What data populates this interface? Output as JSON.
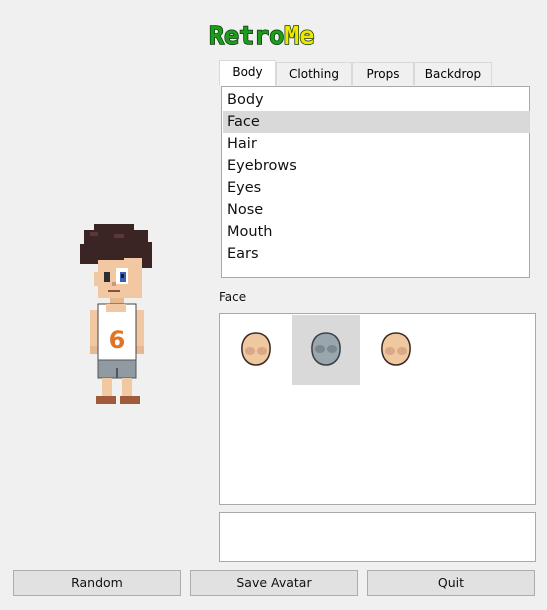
{
  "app": {
    "logo_text": "RetroMe"
  },
  "tabs": [
    {
      "label": "Body",
      "active": true
    },
    {
      "label": "Clothing",
      "active": false
    },
    {
      "label": "Props",
      "active": false
    },
    {
      "label": "Backdrop",
      "active": false
    }
  ],
  "body_parts": {
    "items": [
      "Body",
      "Face",
      "Hair",
      "Eyebrows",
      "Eyes",
      "Nose",
      "Mouth",
      "Ears"
    ],
    "selected": "Face"
  },
  "options": {
    "label": "Face",
    "items": [
      {
        "icon": "face-shape-icon",
        "color": "#f0c8a0",
        "selected": false
      },
      {
        "icon": "face-shape-icon",
        "color": "#9aa6ad",
        "selected": true
      },
      {
        "icon": "face-shape-icon",
        "color": "#f0c8a0",
        "selected": false
      }
    ]
  },
  "notes": {
    "text": ""
  },
  "buttons": {
    "random": "Random",
    "save": "Save Avatar",
    "quit": "Quit"
  },
  "colors": {
    "logo_green": "#1e9c1e",
    "logo_yellow": "#f2e600",
    "selection": "#d9d9d9"
  }
}
